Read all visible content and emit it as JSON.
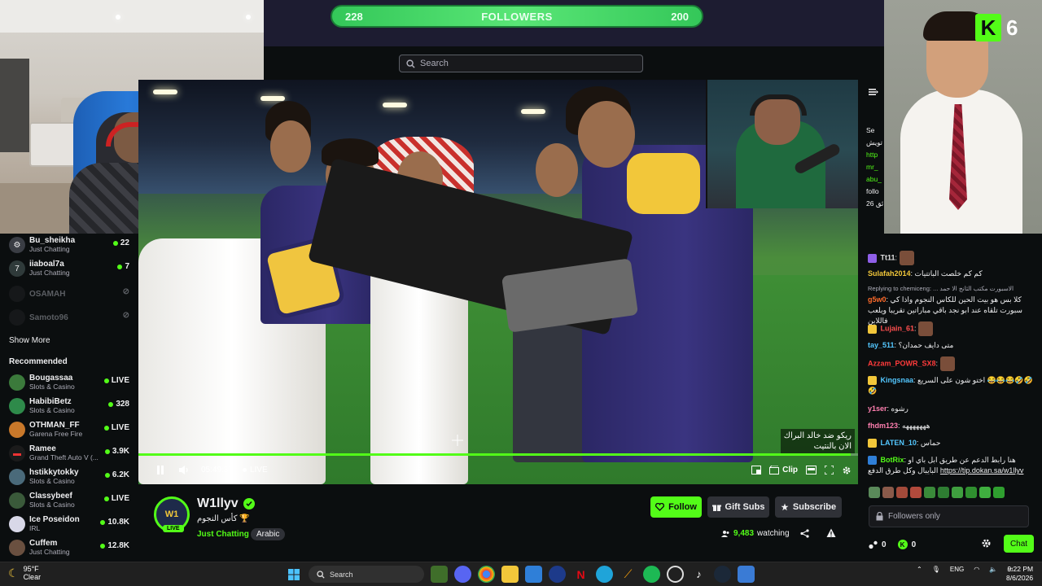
{
  "overlay": {
    "followers_goal": {
      "label": "FOLLOWERS",
      "current": "228",
      "target": "200"
    },
    "kick_badge": {
      "count": "6"
    }
  },
  "search": {
    "placeholder": "Search"
  },
  "player": {
    "timestamp": "05:49:37",
    "live_label": "LIVE",
    "clip_label": "Clip",
    "progress_fraction": 0.99,
    "caption_line1": "ريكو ضد خالد البراك",
    "caption_line2": "الان بالنتيت"
  },
  "sidebar": {
    "following": [
      {
        "name": "Bu_sheikha",
        "sub": "Just Chatting",
        "stat": "22",
        "live": true
      },
      {
        "name": "iiaboal7a",
        "sub": "Just Chatting",
        "stat": "7",
        "live": true
      },
      {
        "name": "OSAMAH",
        "sub": "",
        "stat": "",
        "live": false
      },
      {
        "name": "Samoto96",
        "sub": "",
        "stat": "",
        "live": false
      }
    ],
    "show_more": "Show More",
    "recommended_title": "Recommended",
    "recommended": [
      {
        "name": "Bougassaa",
        "sub": "Slots & Casino",
        "stat": "LIVE"
      },
      {
        "name": "HabibiBetz",
        "sub": "Slots & Casino",
        "stat": "328"
      },
      {
        "name": "OTHMAN_FF",
        "sub": "Garena Free Fire",
        "stat": "LIVE"
      },
      {
        "name": "Ramee",
        "sub": "Grand Theft Auto V (...",
        "stat": "3.9K"
      },
      {
        "name": "hstikkytokky",
        "sub": "Slots & Casino",
        "stat": "6.2K"
      },
      {
        "name": "Classybeef",
        "sub": "Slots & Casino",
        "stat": "LIVE"
      },
      {
        "name": "Ice Poseidon",
        "sub": "IRL",
        "stat": "10.8K"
      },
      {
        "name": "Cuffem",
        "sub": "Just Chatting",
        "stat": "12.8K"
      }
    ]
  },
  "channel": {
    "name": "W1llyv",
    "title": "كأس النجوم 🏆",
    "category": "Just Chatting",
    "tag": "Arabic",
    "live_pill": "LIVE",
    "follow_label": "Follow",
    "gift_label": "Gift Subs",
    "subscribe_label": "Subscribe",
    "watching_count": "9,483",
    "watching_label": "watching"
  },
  "chat": {
    "pinned": [
      "Se",
      "تويش",
      "http",
      "mr_",
      "abu_",
      "",
      "follo",
      "26 دقائق"
    ],
    "messages": [
      {
        "user": "Tt11",
        "color": "#e0e0e0",
        "text": ":",
        "emote": true,
        "badge": "#8f5fe8"
      },
      {
        "user": "Sulafah2014",
        "color": "#f2c73a",
        "text": ": كم كم خلصت الباتتيات",
        "emote": false
      },
      {
        "reply": "Replying to chemiceng: ... الاسبورت مكتب الثانج الا حمد"
      },
      {
        "user": "g5w0",
        "color": "#ff6b2b",
        "text": ": كلا بس هو بيت الحين للكاس النجوم واذا كي سبورت تلقاه عند ابو نجد باقي مباراتين تقريبا ويلعب فاللاين",
        "emote": false
      },
      {
        "user": "Lujain_61",
        "color": "#ff4f4f",
        "text": ":",
        "emote": true,
        "badge": "#f2c73a"
      },
      {
        "user": "tay_511",
        "color": "#53c7ff",
        "text": ": متى دايف حمدان؟",
        "emote": false
      },
      {
        "user": "Azzam_POWR_SX8",
        "color": "#ff3b3b",
        "text": ":",
        "emote": true
      },
      {
        "user": "Kingsnaa",
        "color": "#53c7ff",
        "text": ": اختو شون على السريع 😂😂😂🤣🤣🤣",
        "emote": false,
        "badge": "#f2c73a"
      },
      {
        "user": "y1ser",
        "color": "#ff7fb0",
        "text": ": رشوه",
        "emote": false
      },
      {
        "user": "fhdm123",
        "color": "#ff7fb0",
        "text": ": هههههههه",
        "emote": false
      },
      {
        "user": "LATEN_10",
        "color": "#53c7ff",
        "text": ": حماس",
        "emote": false,
        "badge": "#f2c73a"
      },
      {
        "user": "BotRix",
        "color": "#53fc18",
        "text": ": هنا رابط الدعم عن طريق ابل باي او البايبال وكل طرق الدفع",
        "link": "https://tip.dokan.sa/w1llyv",
        "emote": false,
        "badge": "#2f7fd8"
      }
    ],
    "input_placeholder": "Followers only",
    "left_count": "0",
    "kick_count": "0",
    "chat_button": "Chat"
  },
  "taskbar": {
    "weather_temp": "95°F",
    "weather_desc": "Clear",
    "search_label": "Search",
    "lang": "ENG",
    "time": "9:22 PM",
    "date": "8/6/2026"
  }
}
